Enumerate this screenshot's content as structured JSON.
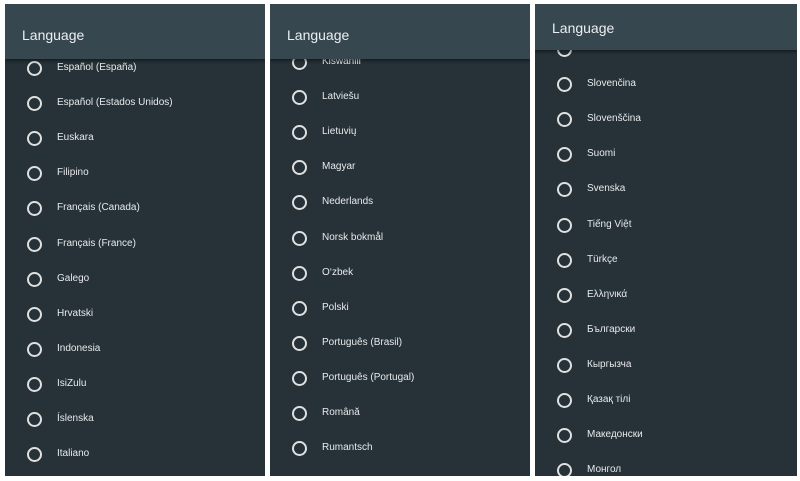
{
  "panels": [
    {
      "title": "Language",
      "items": [
        {
          "label": "Español (España)",
          "selected": false
        },
        {
          "label": "Español (Estados Unidos)",
          "selected": false
        },
        {
          "label": "Euskara",
          "selected": false
        },
        {
          "label": "Filipino",
          "selected": false
        },
        {
          "label": "Français (Canada)",
          "selected": false
        },
        {
          "label": "Français (France)",
          "selected": false
        },
        {
          "label": "Galego",
          "selected": false
        },
        {
          "label": "Hrvatski",
          "selected": false
        },
        {
          "label": "Indonesia",
          "selected": false
        },
        {
          "label": "IsiZulu",
          "selected": false
        },
        {
          "label": "Íslenska",
          "selected": false
        },
        {
          "label": "Italiano",
          "selected": false
        }
      ]
    },
    {
      "title": "Language",
      "items": [
        {
          "label": "Kiswahili",
          "selected": false
        },
        {
          "label": "Latviešu",
          "selected": false
        },
        {
          "label": "Lietuvių",
          "selected": false
        },
        {
          "label": "Magyar",
          "selected": false
        },
        {
          "label": "Nederlands",
          "selected": false
        },
        {
          "label": "Norsk bokmål",
          "selected": false
        },
        {
          "label": "O‘zbek",
          "selected": false
        },
        {
          "label": "Polski",
          "selected": false
        },
        {
          "label": "Português (Brasil)",
          "selected": false
        },
        {
          "label": "Português (Portugal)",
          "selected": false
        },
        {
          "label": "Română",
          "selected": false
        },
        {
          "label": "Rumantsch",
          "selected": false
        }
      ]
    },
    {
      "title": "Language",
      "items": [
        {
          "label": "",
          "selected": false
        },
        {
          "label": "Slovenčina",
          "selected": false
        },
        {
          "label": "Slovenščina",
          "selected": false
        },
        {
          "label": "Suomi",
          "selected": false
        },
        {
          "label": "Svenska",
          "selected": false
        },
        {
          "label": "Tiếng Việt",
          "selected": false
        },
        {
          "label": "Türkçe",
          "selected": false
        },
        {
          "label": "Ελληνικά",
          "selected": false
        },
        {
          "label": "Български",
          "selected": false
        },
        {
          "label": "Кыргызча",
          "selected": false
        },
        {
          "label": "Қазақ тілі",
          "selected": false
        },
        {
          "label": "Македонски",
          "selected": false
        },
        {
          "label": "Монгол",
          "selected": false
        }
      ]
    }
  ],
  "colors": {
    "panel_bg": "#263238",
    "header_bg": "#37474f",
    "text": "#e8eaec"
  },
  "icons": {
    "radio": "radio-unchecked-icon"
  }
}
